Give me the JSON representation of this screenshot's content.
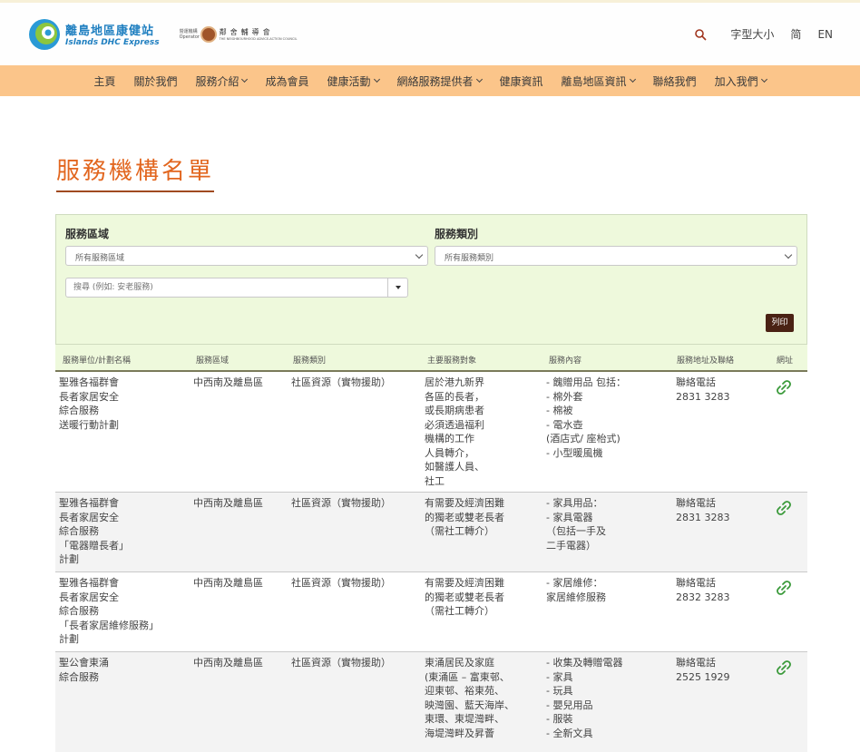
{
  "header": {
    "logo_zh": "離島地區康健站",
    "logo_en": "Islands DHC Express",
    "operator_label": "營運機構 Operator",
    "operator_name_zh": "鄰舍輔導會",
    "operator_name_en": "THE NEIGHBOURHOOD ADVICE-ACTION COUNCIL",
    "font_size_label": "字型大小",
    "simplified_label": "简",
    "english_label": "EN",
    "search_icon": "search-icon"
  },
  "nav": {
    "items": [
      {
        "label": "主頁",
        "dropdown": false
      },
      {
        "label": "關於我們",
        "dropdown": false
      },
      {
        "label": "服務介紹",
        "dropdown": true
      },
      {
        "label": "成為會員",
        "dropdown": false
      },
      {
        "label": "健康活動",
        "dropdown": true
      },
      {
        "label": "網絡服務提供者",
        "dropdown": true
      },
      {
        "label": "健康資訊",
        "dropdown": false
      },
      {
        "label": "離島地區資訊",
        "dropdown": true
      },
      {
        "label": "聯絡我們",
        "dropdown": false
      },
      {
        "label": "加入我們",
        "dropdown": true
      }
    ]
  },
  "page": {
    "title": "服務機構名單"
  },
  "filter": {
    "region_label": "服務區域",
    "region_value": "所有服務區域",
    "type_label": "服務類別",
    "type_value": "所有服務類別",
    "search_placeholder": "搜尋 (例如: 安老服務)",
    "print_label": "列印"
  },
  "table": {
    "headers": [
      "服務單位/計劃名稱",
      "服務區域",
      "服務類別",
      "主要服務對象",
      "服務內容",
      "服務地址及聯絡",
      "網址"
    ],
    "rows": [
      {
        "name": "聖雅各福群會\n長者家居安全\n綜合服務\n送暖行動計劃",
        "region": "中西南及離島區",
        "type": "社區資源（實物援助）",
        "target": "居於港九新界\n各區的長者，\n或長期病患者\n必須透過福利\n機構的工作\n人員轉介，\n如醫護人員、\n社工",
        "content": "- 餽贈用品 包括：\n- 棉外套\n- 棉被\n- 電水壺\n  (酒店式/ 座枱式)\n- 小型暖風機",
        "contact": "聯絡電話\n2831 3283"
      },
      {
        "name": "聖雅各福群會\n長者家居安全\n綜合服務\n「電器贈長者」\n計劃",
        "region": "中西南及離島區",
        "type": "社區資源（實物援助）",
        "target": "有需要及經濟困難\n的獨老或雙老長者\n（需社工轉介）",
        "content": "- 家具用品：\n- 家具電器\n（包括一手及\n   二手電器）",
        "contact": "聯絡電話\n2831 3283"
      },
      {
        "name": "聖雅各福群會\n長者家居安全\n綜合服務\n「長者家居維修服務」\n計劃",
        "region": "中西南及離島區",
        "type": "社區資源（實物援助）",
        "target": "有需要及經濟困難\n的獨老或雙老長者\n（需社工轉介）",
        "content": "- 家居維修：\n  家居維修服務",
        "contact": "聯絡電話\n2832 3283"
      },
      {
        "name": "聖公會東涌\n綜合服務",
        "region": "中西南及離島區",
        "type": "社區資源（實物援助）",
        "target": "東涌居民及家庭\n(東涌區 – 富東邨、\n迎東邨、裕東苑、\n映灣園、藍天海岸、\n東環、東堤灣畔、\n海堤灣畔及昇薈",
        "content": "- 收集及轉贈電器\n- 家具\n- 玩具\n- 嬰兒用品\n- 服裝\n- 全新文具",
        "contact": "聯絡電話\n2525 1929"
      }
    ]
  },
  "colors": {
    "nav_bg": "#fbc58a",
    "title": "#e2661f",
    "filter_bg": "#eef9dc",
    "print_btn": "#4a2214",
    "link_icon": "#3a9a3a"
  }
}
